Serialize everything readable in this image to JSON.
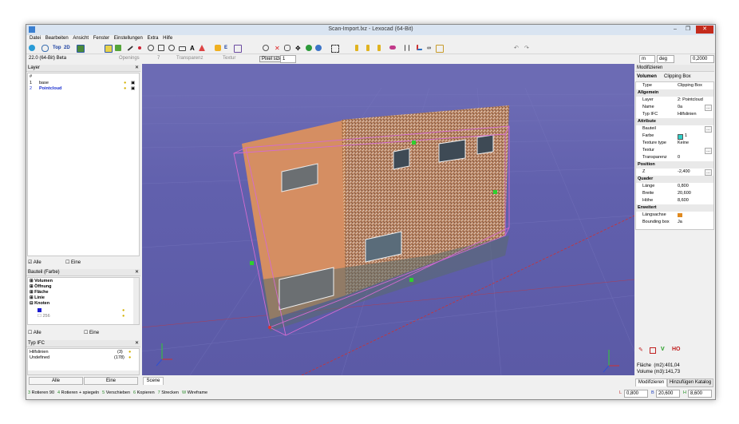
{
  "window": {
    "title": "Scan-Import.lxz - Lexocad (64-Bit)",
    "minimize": "–",
    "maximize": "❐",
    "close": "✕"
  },
  "menu": [
    "Datei",
    "Bearbeiten",
    "Ansicht",
    "Fenster",
    "Einstellungen",
    "Extra",
    "Hilfe"
  ],
  "toolbar": {
    "top_label": "Top",
    "view2d_label": "2D"
  },
  "secondbar": {
    "version": "22.0 (64-Bit) Beta",
    "toggles": [
      "Openings",
      "7",
      "Transparenz",
      "Textur"
    ],
    "pixel_size_label": "Pixel size",
    "pixel_size_value": "1",
    "unit_length": "m",
    "unit_angle": "deg",
    "snap_value": "0,2000"
  },
  "layer_panel": {
    "title": "Layer",
    "header": "#",
    "rows": [
      {
        "num": "1",
        "name": "base"
      },
      {
        "num": "2",
        "name": "Pointcloud"
      }
    ],
    "alle": "Alle",
    "eine": "Eine"
  },
  "bauteil_panel": {
    "title": "Bauteil (Farbe)",
    "items": [
      "Volumen",
      "Öffnung",
      "Fläche",
      "Linie",
      "Knoten"
    ],
    "sub_color": "256",
    "alle": "Alle",
    "eine": "Eine"
  },
  "typifc_panel": {
    "title": "Typ IFC",
    "rows": [
      {
        "name": "Hilfslinien",
        "count": "(3)"
      },
      {
        "name": "Undefined",
        "count": "(178)"
      }
    ],
    "alle_btn": "Alle",
    "eine_btn": "Eine"
  },
  "scene_tab": "Scene",
  "modifier_panel": {
    "title": "Modifizieren",
    "header_left": "Volumen",
    "header_right": "Clipping Box",
    "rows": [
      {
        "k": "Type",
        "v": "Clipping Box",
        "section": false
      },
      {
        "k": "Allgemein",
        "v": "",
        "section": true
      },
      {
        "k": "Layer",
        "v": "2: Pointcloud",
        "section": false
      },
      {
        "k": "Name",
        "v": "0a",
        "section": false
      },
      {
        "k": "Typ IFC",
        "v": "Hilfslinien",
        "section": false
      },
      {
        "k": "Attribute",
        "v": "",
        "section": true
      },
      {
        "k": "Bauteil",
        "v": "",
        "section": false
      },
      {
        "k": "Farbe",
        "v": "1",
        "section": false
      },
      {
        "k": "Texture type",
        "v": "Keine",
        "section": false
      },
      {
        "k": "Textur",
        "v": "",
        "section": false
      },
      {
        "k": "Transparenz",
        "v": "0",
        "section": false
      },
      {
        "k": "Position",
        "v": "",
        "section": true
      },
      {
        "k": "Z",
        "v": "-2,400",
        "section": false
      },
      {
        "k": "Quader",
        "v": "",
        "section": true
      },
      {
        "k": "Länge",
        "v": "0,800",
        "section": false
      },
      {
        "k": "Breite",
        "v": "20,600",
        "section": false
      },
      {
        "k": "Höhe",
        "v": "8,600",
        "section": false
      },
      {
        "k": "Erweitert",
        "v": "",
        "section": true
      },
      {
        "k": "Längsachse",
        "v": "",
        "section": false
      },
      {
        "k": "Bounding box",
        "v": "Ja",
        "section": false
      }
    ],
    "action_v": "V",
    "action_ho": "HO",
    "area_label": "Fläche",
    "area_value": "(m2):401,04",
    "volume_label": "Volume",
    "volume_value": "(m3):141,73",
    "tabs": [
      "Modifizieren",
      "Hinzufügen Katalog"
    ],
    "farbe_color": "#2fd0c8"
  },
  "status": {
    "hints": [
      {
        "key": "3",
        "label": "Rotieren 90"
      },
      {
        "key": "4",
        "label": "Rotieren + spiegeln"
      },
      {
        "key": "5",
        "label": "Verschieben"
      },
      {
        "key": "6",
        "label": "Kopieren"
      },
      {
        "key": "7",
        "label": "Strecken"
      },
      {
        "key": "W",
        "label": "Wireframe"
      }
    ],
    "l_label": "L",
    "l_value": "0,800",
    "b_label": "B",
    "b_value": "20,600",
    "h_label": "H",
    "h_value": "8,600"
  },
  "colors": {
    "viewport": "#6160ad",
    "selection": "#d36bd0",
    "facade": "#c98a5e"
  }
}
